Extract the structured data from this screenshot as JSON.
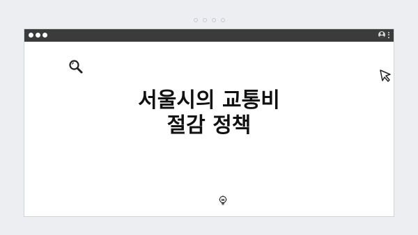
{
  "slide": {
    "title_line_1": "서울시의 교통비",
    "title_line_2": "절감 정책"
  },
  "window": {
    "titlebar_color": "#3b3b3b",
    "background_color": "#ffffff",
    "controls": [
      "dot",
      "dot",
      "dot"
    ]
  },
  "icons": {
    "top_left": "search-icon",
    "top_right": "cursor-icon",
    "bottom": "lightbulb-icon",
    "titlebar_user": "user-icon",
    "titlebar_menu": "kebab-menu-icon"
  },
  "carousel": {
    "page_indicator_count": 4
  }
}
